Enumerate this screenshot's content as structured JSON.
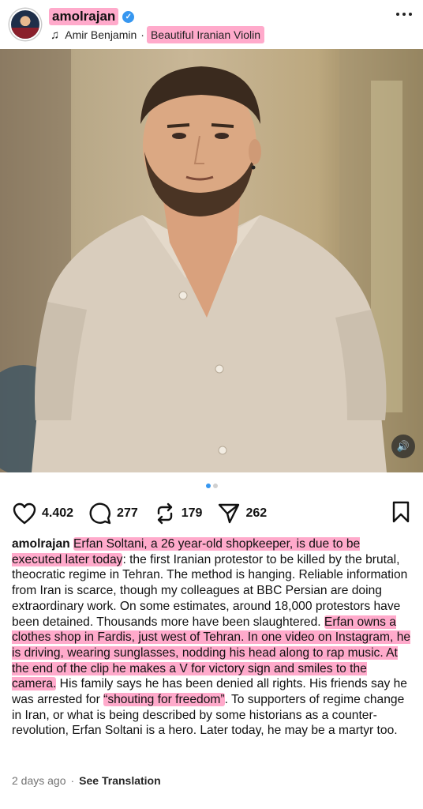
{
  "post": {
    "username": "amolrajan",
    "music_artist": "Amir Benjamin",
    "separator": "·",
    "music_title": "Beautiful Iranian Violin"
  },
  "actions": {
    "likes": "4.402",
    "comments": "277",
    "reposts": "179",
    "shares": "262"
  },
  "carousel": {
    "total": 2,
    "active": 1
  },
  "caption": {
    "username": "amolrajan",
    "seg1_hl": "Erfan Soltani, a 26 year-old shopkeeper, is due to be executed later today",
    "seg2": ": the first Iranian protestor to be killed by the brutal, theocratic regime in Tehran. The method is hanging. Reliable information from Iran is scarce, though my colleagues at BBC Persian are doing extraordinary work. On some estimates, around 18,000 protestors have been detained. Thousands more have been slaughtered. ",
    "seg3_hl": "Erfan owns a clothes shop in Fardis, just west of Tehran. In one video on Instagram, he is driving, wearing sunglasses, nodding his head along to rap music. At the end of the clip he makes a V for victory sign and smiles to the camera.",
    "seg4": " His family says he has been denied all rights. His friends say he was arrested for ",
    "seg5_hl": "“shouting for freedom”",
    "seg6": ". To supporters of regime change in Iran, or what is being described by some historians as a counter-revolution, Erfan Soltani is a hero. Later today, he may be a martyr too."
  },
  "footer": {
    "time": "2 days ago",
    "dot": "·",
    "translate": "See Translation"
  },
  "colors": {
    "highlight": "#ff64a0",
    "verified": "#3797f0",
    "meta_text": "#737373"
  },
  "icons": [
    "verified-badge-icon",
    "music-note-icon",
    "more-options-icon",
    "volume-icon",
    "heart-icon",
    "comment-icon",
    "repost-icon",
    "share-icon",
    "bookmark-icon"
  ]
}
